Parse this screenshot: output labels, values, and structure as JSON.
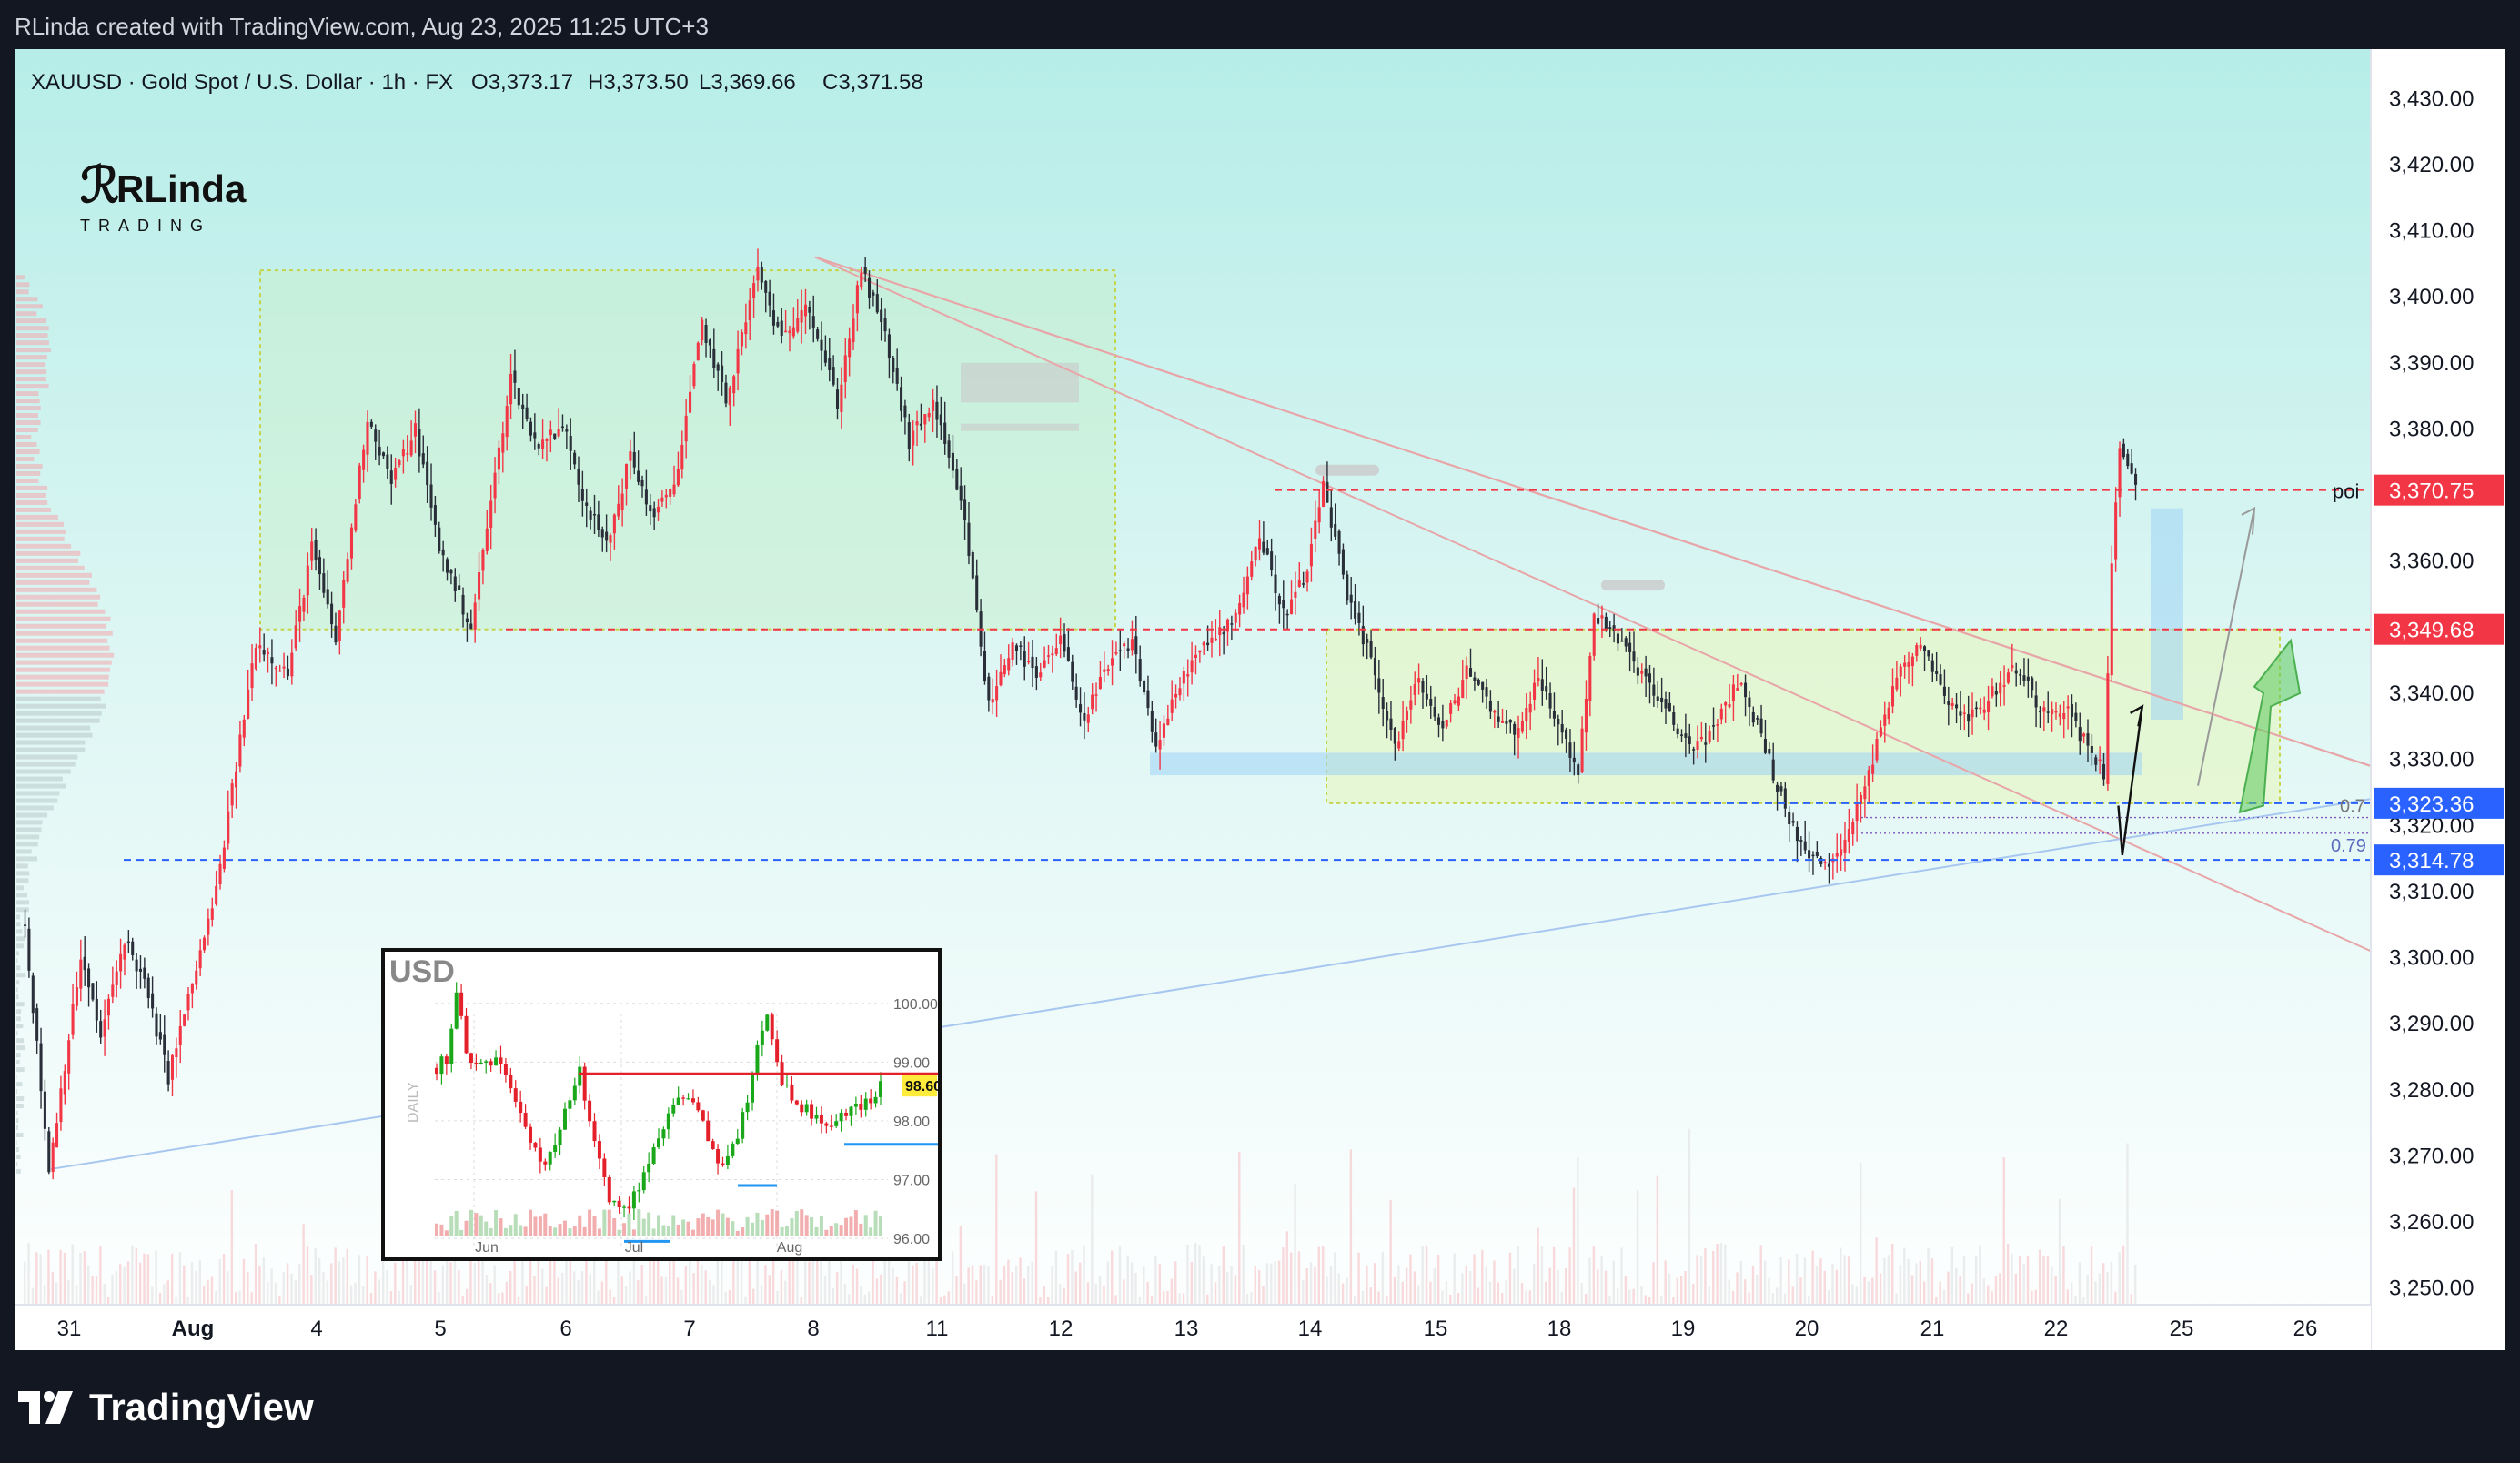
{
  "header": {
    "credit": "RLinda created with TradingView.com, Aug 23, 2025 11:25 UTC+3"
  },
  "legend": {
    "symbol": "XAUUSD · Gold Spot / U.S. Dollar · 1h · FX",
    "open": "O3,373.17",
    "high": "H3,373.50",
    "low": "L3,369.66",
    "close": "C3,371.58"
  },
  "brand": {
    "name": "RLinda",
    "sub": "TRADING"
  },
  "footer": {
    "logo_text": "TradingView"
  },
  "colors": {
    "up": "#f23645",
    "down": "#2a2e39",
    "panel": "#b9ece8",
    "red_line": "#f23645",
    "blue_line": "#2962ff"
  },
  "chart_data": [
    {
      "type": "candlestick",
      "x_ticks": [
        "31",
        "Aug",
        "4",
        "5",
        "6",
        "7",
        "8",
        "11",
        "12",
        "13",
        "14",
        "15",
        "18",
        "19",
        "20",
        "21",
        "22",
        "25",
        "26"
      ],
      "y_ticks": [
        "3,430.00",
        "3,420.00",
        "3,410.00",
        "3,400.00",
        "3,390.00",
        "3,380.00",
        "3,370.00",
        "3,360.00",
        "3,350.00",
        "3,340.00",
        "3,330.00",
        "3,320.00",
        "3,310.00",
        "3,300.00",
        "3,290.00",
        "3,280.00",
        "3,270.00",
        "3,260.00",
        "3,250.00"
      ],
      "ylim": [
        3245,
        3435
      ],
      "levels": [
        {
          "label": "3,370.75",
          "value": 3370.75,
          "color": "#f23645",
          "note": "poi"
        },
        {
          "label": "3,349.68",
          "value": 3349.68,
          "color": "#f23645"
        },
        {
          "label": "3,323.36",
          "value": 3323.36,
          "color": "#2962ff"
        },
        {
          "label": "3,314.78",
          "value": 3314.78,
          "color": "#2962ff"
        }
      ],
      "fib": [
        "0.7",
        "0.79"
      ],
      "path": [
        [
          0,
          3305
        ],
        [
          6,
          3268
        ],
        [
          14,
          3300
        ],
        [
          19,
          3288
        ],
        [
          25,
          3303
        ],
        [
          30,
          3296
        ],
        [
          36,
          3282
        ],
        [
          42,
          3296
        ],
        [
          48,
          3310
        ],
        [
          58,
          3348
        ],
        [
          66,
          3343
        ],
        [
          72,
          3362
        ],
        [
          78,
          3348
        ],
        [
          86,
          3382
        ],
        [
          92,
          3372
        ],
        [
          98,
          3380
        ],
        [
          104,
          3362
        ],
        [
          112,
          3350
        ],
        [
          122,
          3388
        ],
        [
          128,
          3378
        ],
        [
          136,
          3380
        ],
        [
          140,
          3370
        ],
        [
          146,
          3362
        ],
        [
          152,
          3376
        ],
        [
          158,
          3366
        ],
        [
          164,
          3374
        ],
        [
          170,
          3396
        ],
        [
          176,
          3384
        ],
        [
          184,
          3404
        ],
        [
          190,
          3393
        ],
        [
          196,
          3400
        ],
        [
          204,
          3384
        ],
        [
          210,
          3404
        ],
        [
          216,
          3394
        ],
        [
          222,
          3378
        ],
        [
          228,
          3384
        ],
        [
          236,
          3366
        ],
        [
          242,
          3338
        ],
        [
          248,
          3348
        ],
        [
          254,
          3342
        ],
        [
          260,
          3348
        ],
        [
          266,
          3336
        ],
        [
          272,
          3344
        ],
        [
          278,
          3348
        ],
        [
          284,
          3332
        ],
        [
          292,
          3344
        ],
        [
          298,
          3348
        ],
        [
          304,
          3352
        ],
        [
          310,
          3364
        ],
        [
          316,
          3352
        ],
        [
          322,
          3358
        ],
        [
          326,
          3372
        ],
        [
          332,
          3354
        ],
        [
          338,
          3345
        ],
        [
          344,
          3332
        ],
        [
          350,
          3342
        ],
        [
          356,
          3334
        ],
        [
          362,
          3344
        ],
        [
          368,
          3338
        ],
        [
          374,
          3334
        ],
        [
          380,
          3342
        ],
        [
          386,
          3334
        ],
        [
          390,
          3328
        ],
        [
          394,
          3352
        ],
        [
          400,
          3348
        ],
        [
          406,
          3343
        ],
        [
          412,
          3337
        ],
        [
          418,
          3332
        ],
        [
          424,
          3334
        ],
        [
          430,
          3342
        ],
        [
          436,
          3334
        ],
        [
          442,
          3322
        ],
        [
          448,
          3315
        ],
        [
          454,
          3314
        ],
        [
          458,
          3320
        ],
        [
          464,
          3330
        ],
        [
          470,
          3343
        ],
        [
          476,
          3348
        ],
        [
          482,
          3340
        ],
        [
          488,
          3336
        ],
        [
          494,
          3340
        ],
        [
          500,
          3344
        ],
        [
          506,
          3338
        ],
        [
          512,
          3338
        ],
        [
          518,
          3332
        ],
        [
          522,
          3328
        ],
        [
          524,
          3360
        ],
        [
          526,
          3376
        ],
        [
          530,
          3371.6
        ]
      ]
    },
    {
      "type": "candlestick",
      "title": "USD",
      "timeframe": "DAILY",
      "x_ticks": [
        "Jun",
        "Jul",
        "Aug"
      ],
      "y_ticks": [
        "100.00",
        "99.00",
        "98.00",
        "97.00",
        "96.00"
      ],
      "last_price": "98.60",
      "ylim": [
        95.8,
        100.6
      ],
      "path": [
        [
          0,
          98.9
        ],
        [
          5,
          99.1
        ],
        [
          8,
          100.2
        ],
        [
          12,
          99.2
        ],
        [
          18,
          98.9
        ],
        [
          24,
          99.0
        ],
        [
          30,
          98.6
        ],
        [
          36,
          98.0
        ],
        [
          42,
          97.2
        ],
        [
          48,
          97.6
        ],
        [
          54,
          98.4
        ],
        [
          58,
          98.9
        ],
        [
          62,
          97.9
        ],
        [
          66,
          97.3
        ],
        [
          70,
          96.7
        ],
        [
          74,
          96.5
        ],
        [
          78,
          96.6
        ],
        [
          84,
          97.1
        ],
        [
          90,
          97.6
        ],
        [
          96,
          98.3
        ],
        [
          102,
          98.4
        ],
        [
          108,
          97.9
        ],
        [
          114,
          97.3
        ],
        [
          120,
          97.5
        ],
        [
          126,
          98.3
        ],
        [
          130,
          99.4
        ],
        [
          134,
          99.7
        ],
        [
          138,
          98.9
        ],
        [
          144,
          98.3
        ],
        [
          150,
          98.2
        ],
        [
          156,
          97.9
        ],
        [
          162,
          98.1
        ],
        [
          168,
          98.2
        ],
        [
          174,
          98.3
        ],
        [
          180,
          98.6
        ]
      ]
    }
  ]
}
